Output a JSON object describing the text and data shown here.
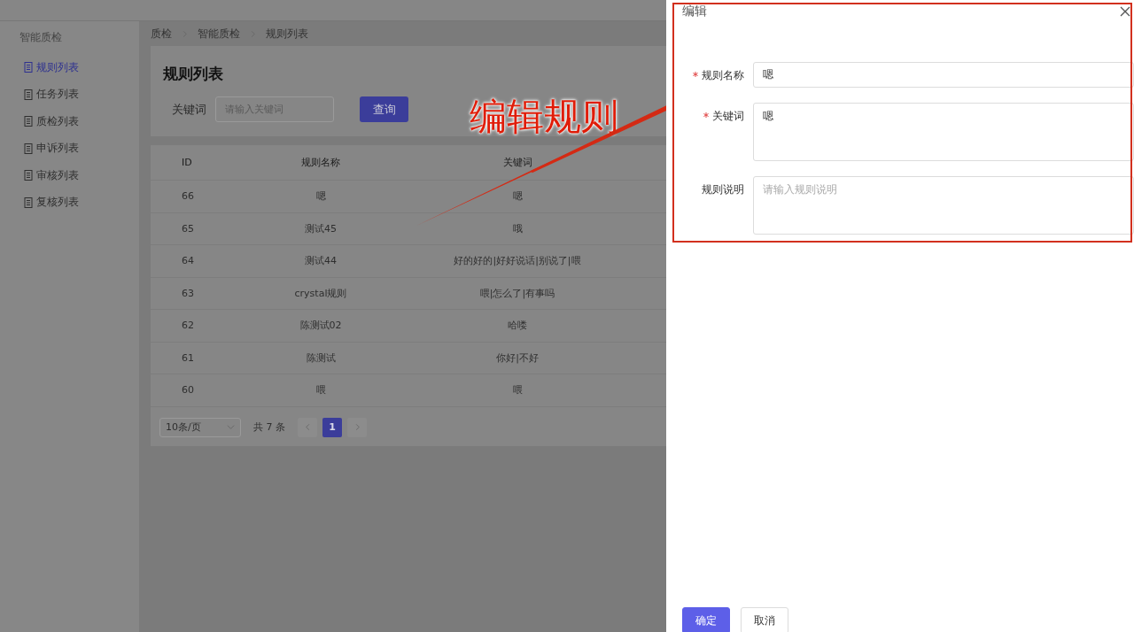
{
  "sidebar": {
    "title": "智能质检",
    "items": [
      {
        "label": "规则列表",
        "selected": true
      },
      {
        "label": "任务列表",
        "selected": false
      },
      {
        "label": "质检列表",
        "selected": false
      },
      {
        "label": "申诉列表",
        "selected": false
      },
      {
        "label": "审核列表",
        "selected": false
      },
      {
        "label": "复核列表",
        "selected": false
      }
    ]
  },
  "breadcrumb": [
    "质检",
    "智能质检",
    "规则列表"
  ],
  "page_title": "规则列表",
  "search": {
    "label": "关键词",
    "placeholder": "请输入关键词",
    "button": "查询"
  },
  "table": {
    "columns": [
      "ID",
      "规则名称",
      "关键词"
    ],
    "rows": [
      [
        "66",
        "嗯",
        "嗯"
      ],
      [
        "65",
        "测试45",
        "哦"
      ],
      [
        "64",
        "测试44",
        "好的好的|好好说话|别说了|喂"
      ],
      [
        "63",
        "crystal规则",
        "喂|怎么了|有事吗"
      ],
      [
        "62",
        "陈测试02",
        "哈喽"
      ],
      [
        "61",
        "陈测试",
        "你好|不好"
      ],
      [
        "60",
        "喂",
        "喂"
      ]
    ]
  },
  "pagination": {
    "page_size": "10条/页",
    "total": "共 7 条",
    "pages": [
      {
        "label": "1",
        "selected": true
      }
    ]
  },
  "drawer": {
    "title": "编辑",
    "fields": [
      {
        "label": "规则名称",
        "required": true,
        "kind": "input",
        "value": "嗯"
      },
      {
        "label": "关键词",
        "required": true,
        "kind": "textarea",
        "value": "嗯"
      },
      {
        "label": "规则说明",
        "required": false,
        "kind": "textarea",
        "placeholder": "请输入规则说明"
      }
    ],
    "buttons": [
      {
        "label": "确定",
        "kind": "primary"
      },
      {
        "label": "取消",
        "kind": "default"
      }
    ]
  },
  "annotation": {
    "text": "编辑规则"
  }
}
